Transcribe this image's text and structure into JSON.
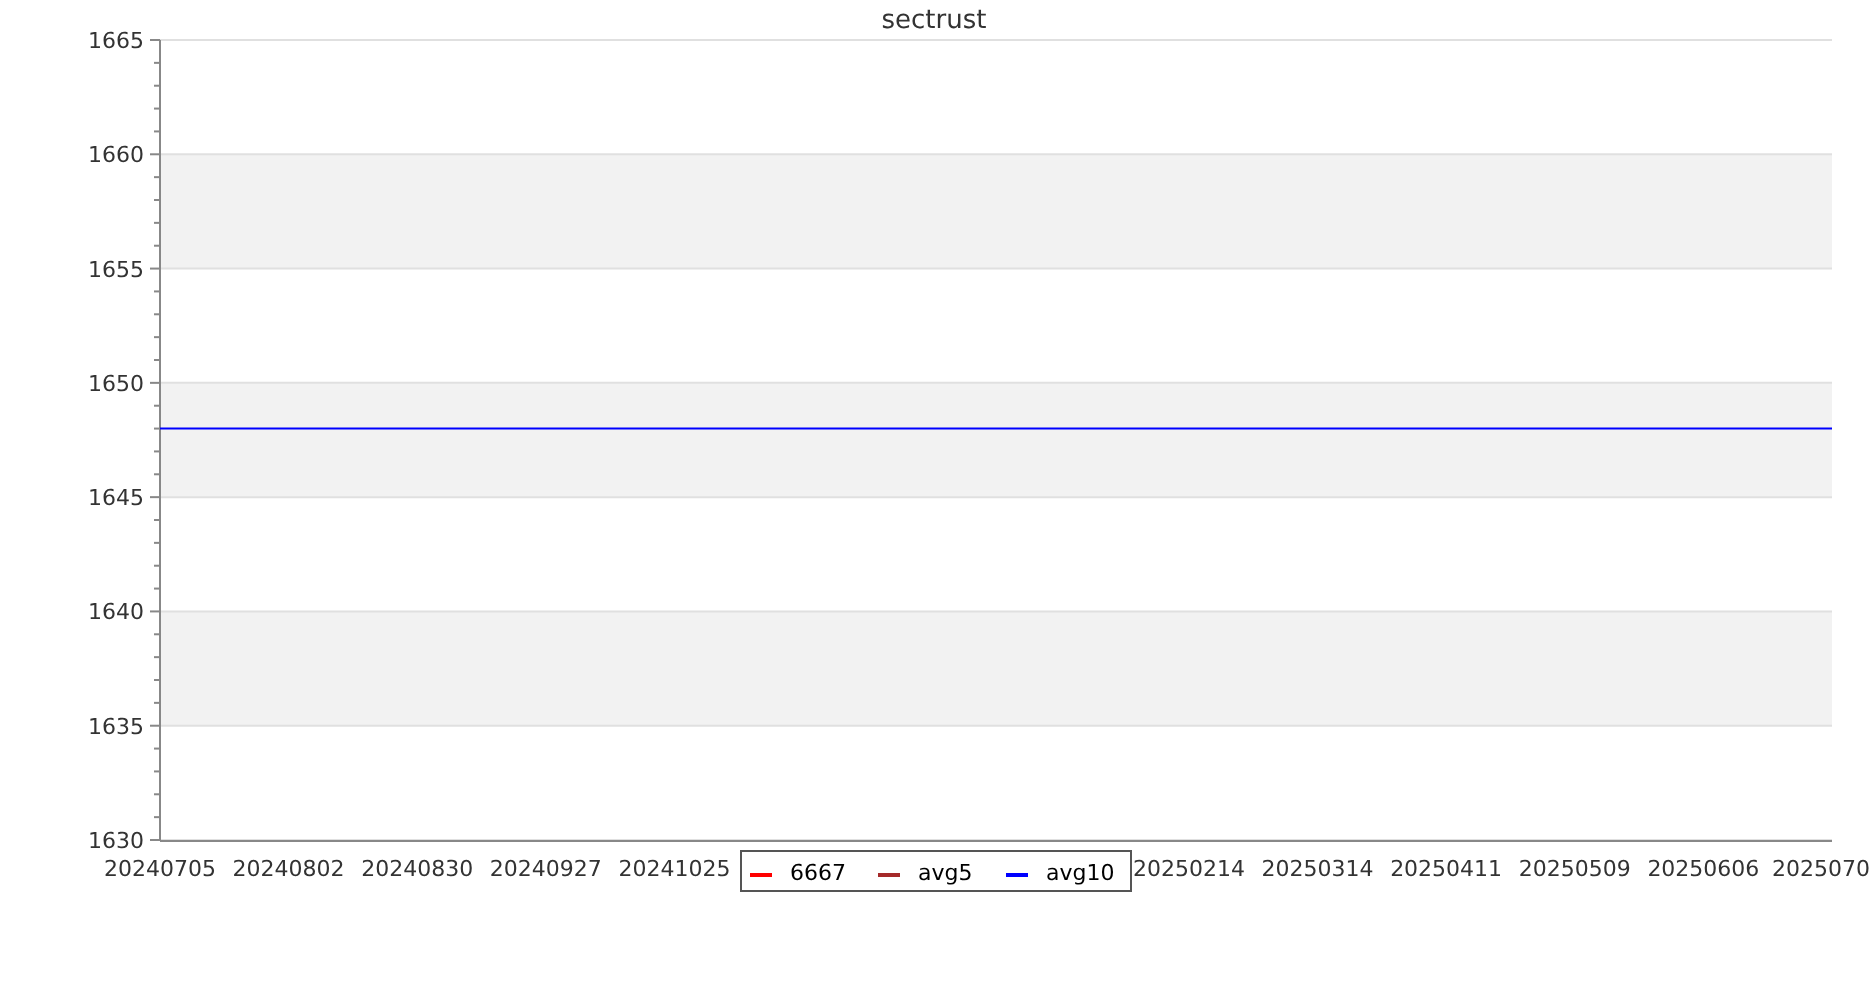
{
  "chart": {
    "chart_data": {
      "type": "line",
      "title": "sectrust",
      "ylim": [
        1630,
        1665
      ],
      "grid": true,
      "yticks": [
        1630,
        1635,
        1640,
        1645,
        1650,
        1655,
        1660,
        1665
      ],
      "categories": [
        "20240705",
        "20240802",
        "20240830",
        "20240927",
        "20241025",
        null,
        null,
        null,
        "20250214",
        "20250314",
        "20250411",
        "20250509",
        "20250606",
        "2025070"
      ],
      "series": [
        {
          "name": "6667",
          "color": "#ff0000",
          "values": [
            null,
            null,
            null,
            null,
            null,
            null,
            null,
            null,
            null,
            null,
            null,
            null,
            null,
            null
          ]
        },
        {
          "name": "avg5",
          "color": "#a52a2a",
          "values": [
            null,
            null,
            null,
            null,
            null,
            null,
            null,
            null,
            null,
            null,
            null,
            null,
            null,
            null
          ]
        },
        {
          "name": "avg10",
          "color": "#0000ff",
          "values": [
            1648,
            1648,
            1648,
            1648,
            1648,
            1648,
            1648,
            1648,
            1648,
            1648,
            1648,
            1648,
            1648,
            1648
          ]
        }
      ]
    }
  }
}
